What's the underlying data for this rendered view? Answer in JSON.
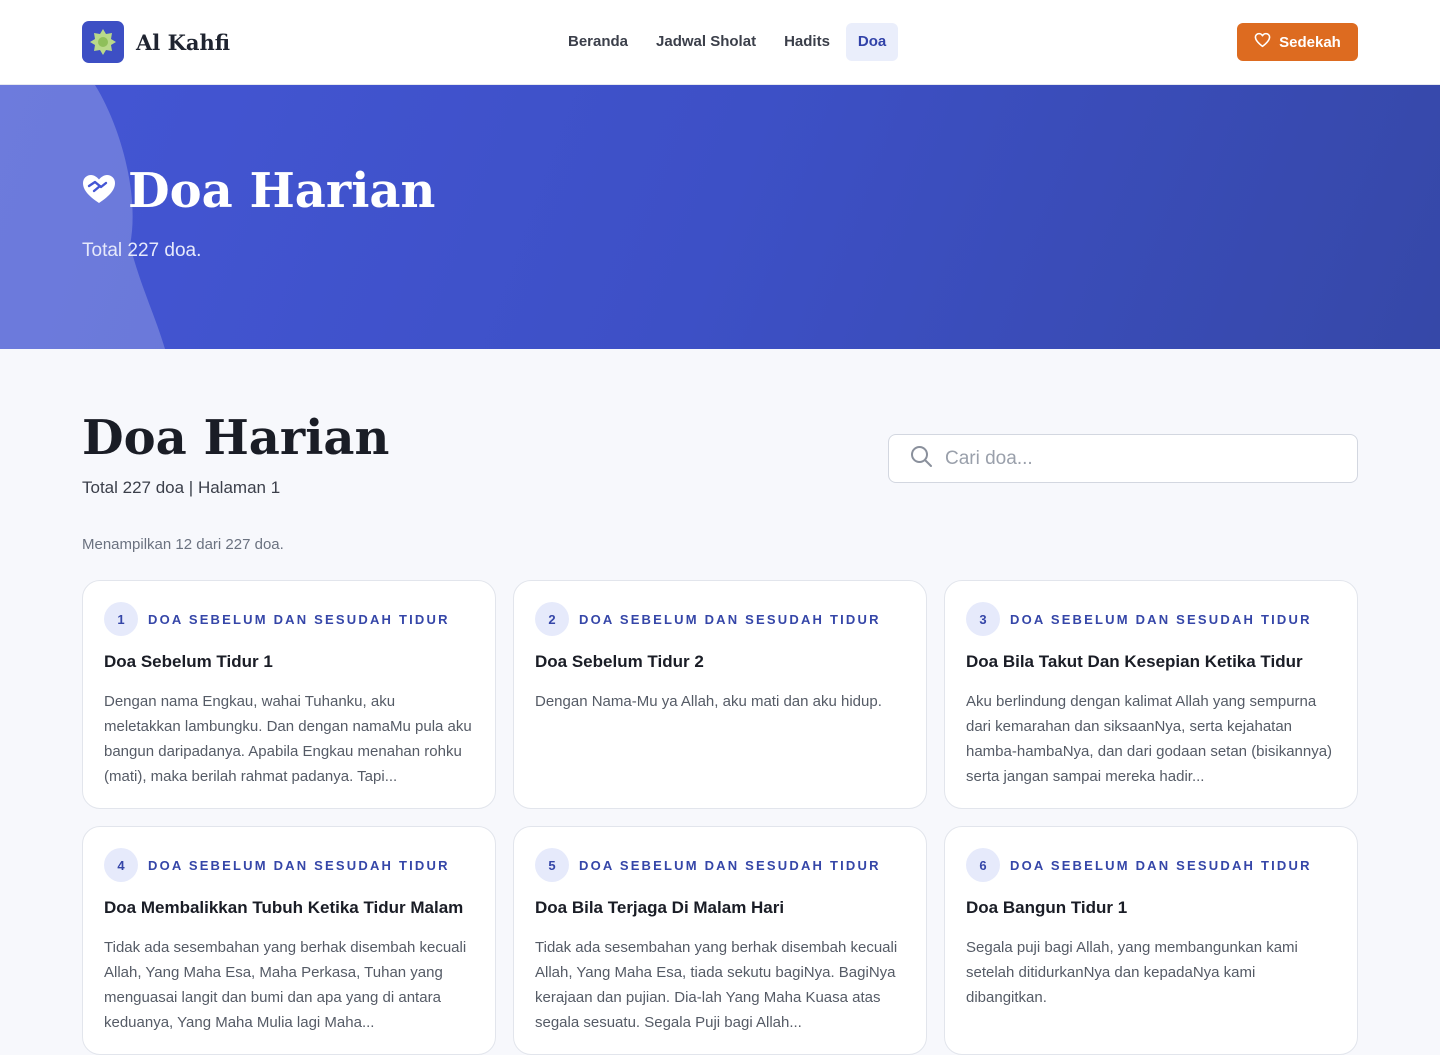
{
  "header": {
    "brand": "Al Kahfi",
    "nav": [
      {
        "label": "Beranda",
        "active": false
      },
      {
        "label": "Jadwal Sholat",
        "active": false
      },
      {
        "label": "Hadits",
        "active": false
      },
      {
        "label": "Doa",
        "active": true
      }
    ],
    "sedekah_label": "Sedekah"
  },
  "hero": {
    "title": "Doa Harian",
    "subtitle": "Total 227 doa."
  },
  "main": {
    "title": "Doa Harian",
    "subtitle": "Total 227 doa | Halaman 1",
    "search_placeholder": "Cari doa...",
    "showing": "Menampilkan 12 dari 227 doa."
  },
  "cards": [
    {
      "num": "1",
      "category": "DOA SEBELUM DAN SESUDAH TIDUR",
      "title": "Doa Sebelum Tidur 1",
      "text": "Dengan nama Engkau, wahai Tuhanku, aku meletakkan lambungku. Dan dengan namaMu pula aku bangun daripadanya. Apabila Engkau menahan rohku (mati), maka berilah rahmat padanya. Tapi..."
    },
    {
      "num": "2",
      "category": "DOA SEBELUM DAN SESUDAH TIDUR",
      "title": "Doa Sebelum Tidur 2",
      "text": "Dengan Nama-Mu ya Allah, aku mati dan aku hidup."
    },
    {
      "num": "3",
      "category": "DOA SEBELUM DAN SESUDAH TIDUR",
      "title": "Doa Bila Takut Dan Kesepian Ketika Tidur",
      "text": "Aku berlindung dengan kalimat Allah yang sempurna dari kemarahan dan siksaanNya, serta kejahatan hamba-hambaNya, dan dari godaan setan (bisikannya) serta jangan sampai mereka hadir..."
    },
    {
      "num": "4",
      "category": "DOA SEBELUM DAN SESUDAH TIDUR",
      "title": "Doa Membalikkan Tubuh Ketika Tidur Malam",
      "text": "Tidak ada sesembahan yang berhak disembah kecuali Allah, Yang Maha Esa, Maha Perkasa, Tuhan yang menguasai langit dan bumi dan apa yang di antara keduanya, Yang Maha Mulia lagi Maha..."
    },
    {
      "num": "5",
      "category": "DOA SEBELUM DAN SESUDAH TIDUR",
      "title": "Doa Bila Terjaga Di Malam Hari",
      "text": "Tidak ada sesembahan yang berhak disembah kecuali Allah, Yang Maha Esa, tiada sekutu bagiNya. BagiNya kerajaan dan pujian. Dia-lah Yang Maha Kuasa atas segala sesuatu. Segala Puji bagi Allah..."
    },
    {
      "num": "6",
      "category": "DOA SEBELUM DAN SESUDAH TIDUR",
      "title": "Doa Bangun Tidur 1",
      "text": "Segala puji bagi Allah, yang membangunkan kami setelah ditidurkanNya dan kepadaNya kami dibangitkan."
    }
  ],
  "colors": {
    "primary": "#3d50c6",
    "accent": "#dd6b20",
    "badge_bg": "#e6eafb"
  },
  "icons": {
    "logo": "star-logo-icon",
    "sedekah": "heart-icon",
    "hero": "heart-handshake-icon",
    "search": "search-icon"
  }
}
